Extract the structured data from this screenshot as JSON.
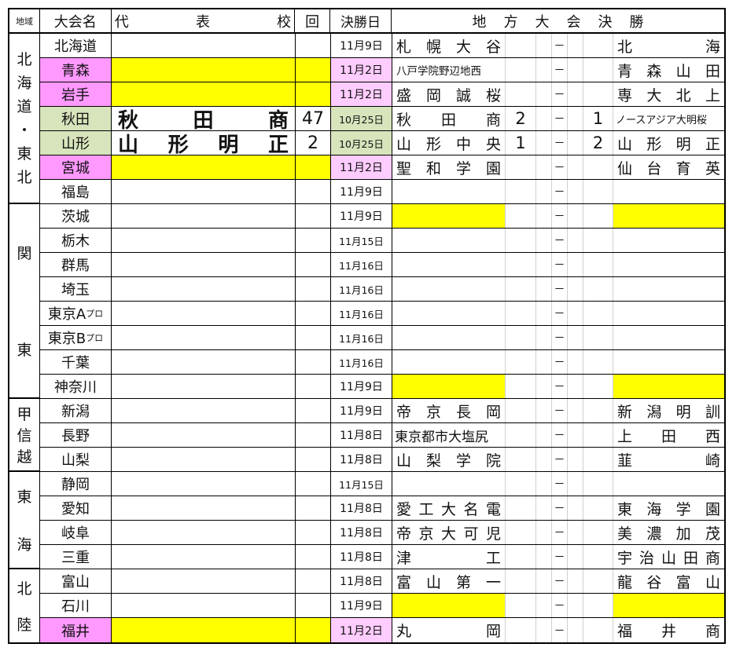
{
  "header": {
    "region": "地域",
    "tournament": "大会名",
    "rep": [
      "代",
      "表",
      "校"
    ],
    "kai": "回",
    "date": "決勝日",
    "final": "地方大会決勝"
  },
  "colors": {
    "pink": "#ff99ff",
    "pink_light": "#ffccff",
    "green": "#d8e4bc",
    "yellow": "#ffff00"
  },
  "regions": [
    {
      "chars": [
        "北",
        "海",
        "道",
        "・",
        "東",
        "北"
      ],
      "rows": 7,
      "layout": "stack"
    },
    {
      "chars": [
        "関",
        "東"
      ],
      "rows": 8,
      "layout": "spread"
    },
    {
      "chars": [
        "甲",
        "信",
        "越"
      ],
      "rows": 3,
      "layout": "stack"
    },
    {
      "chars": [
        "東",
        "海"
      ],
      "rows": 4,
      "layout": "spread"
    },
    {
      "chars": [
        "北",
        "陸"
      ],
      "rows": 3,
      "layout": "spread"
    }
  ],
  "rows": [
    {
      "name": "北海道",
      "date": "11月9日",
      "winner": "札幌大谷",
      "dash": "－",
      "runner": "北海"
    },
    {
      "name": "青森",
      "style": "pink",
      "date": "11月2日",
      "winner": "八戸学院野辺地西",
      "winner_small": true,
      "dash": "－",
      "runner": "青森山田"
    },
    {
      "name": "岩手",
      "style": "pink",
      "date": "11月2日",
      "winner": "盛岡誠桜",
      "dash": "－",
      "runner": "専大北上"
    },
    {
      "name": "秋田",
      "style": "green",
      "rep": "秋田商",
      "kai": "47",
      "date": "10月25日",
      "winner": "秋田商",
      "s1": "2",
      "dash": "－",
      "s2": "1",
      "runner": "ノースアジア大明桜",
      "runner_small": true
    },
    {
      "name": "山形",
      "style": "green",
      "rep": "山形明正",
      "kai": "2",
      "date": "10月25日",
      "winner": "山形中央",
      "s1": "1",
      "dash": "－",
      "s2": "2",
      "runner": "山形明正"
    },
    {
      "name": "宮城",
      "style": "pink",
      "date": "11月2日",
      "winner": "聖和学園",
      "dash": "－",
      "runner": "仙台育英"
    },
    {
      "name": "福島",
      "date": "11月9日",
      "dash": "－"
    },
    {
      "name": "茨城",
      "date": "11月9日",
      "dash": "－",
      "result_yellow": true
    },
    {
      "name": "栃木",
      "date": "11月15日",
      "dash": "－"
    },
    {
      "name": "群馬",
      "date": "11月16日",
      "dash": "－"
    },
    {
      "name": "埼玉",
      "date": "11月16日",
      "dash": "－"
    },
    {
      "name": "東京A",
      "suffix": "プロ",
      "date": "11月16日",
      "dash": "－"
    },
    {
      "name": "東京B",
      "suffix": "プロ",
      "date": "11月16日",
      "dash": "－"
    },
    {
      "name": "千葉",
      "date": "11月16日",
      "dash": "－"
    },
    {
      "name": "神奈川",
      "date": "11月9日",
      "dash": "－",
      "result_yellow": true
    },
    {
      "name": "新潟",
      "date": "11月9日",
      "winner": "帝京長岡",
      "dash": "－",
      "runner": "新潟明訓"
    },
    {
      "name": "長野",
      "date": "11月8日",
      "winner": "東京都市大塩尻",
      "winner_small2": true,
      "dash": "－",
      "runner": "上田西"
    },
    {
      "name": "山梨",
      "date": "11月8日",
      "winner": "山梨学院",
      "dash": "－",
      "runner": "韮崎"
    },
    {
      "name": "静岡",
      "date": "11月15日",
      "dash": "－"
    },
    {
      "name": "愛知",
      "date": "11月8日",
      "winner": "愛工大名電",
      "dash": "－",
      "runner": "東海学園"
    },
    {
      "name": "岐阜",
      "date": "11月8日",
      "winner": "帝京大可児",
      "dash": "－",
      "runner": "美濃加茂"
    },
    {
      "name": "三重",
      "date": "11月8日",
      "winner": "津工",
      "dash": "－",
      "runner": "宇治山田商"
    },
    {
      "name": "富山",
      "date": "11月8日",
      "winner": "富山第一",
      "dash": "－",
      "runner": "龍谷富山"
    },
    {
      "name": "石川",
      "date": "11月9日",
      "dash": "－",
      "result_yellow": true
    },
    {
      "name": "福井",
      "style": "pink",
      "date": "11月2日",
      "winner": "丸岡",
      "dash": "－",
      "runner": "福井商"
    }
  ]
}
